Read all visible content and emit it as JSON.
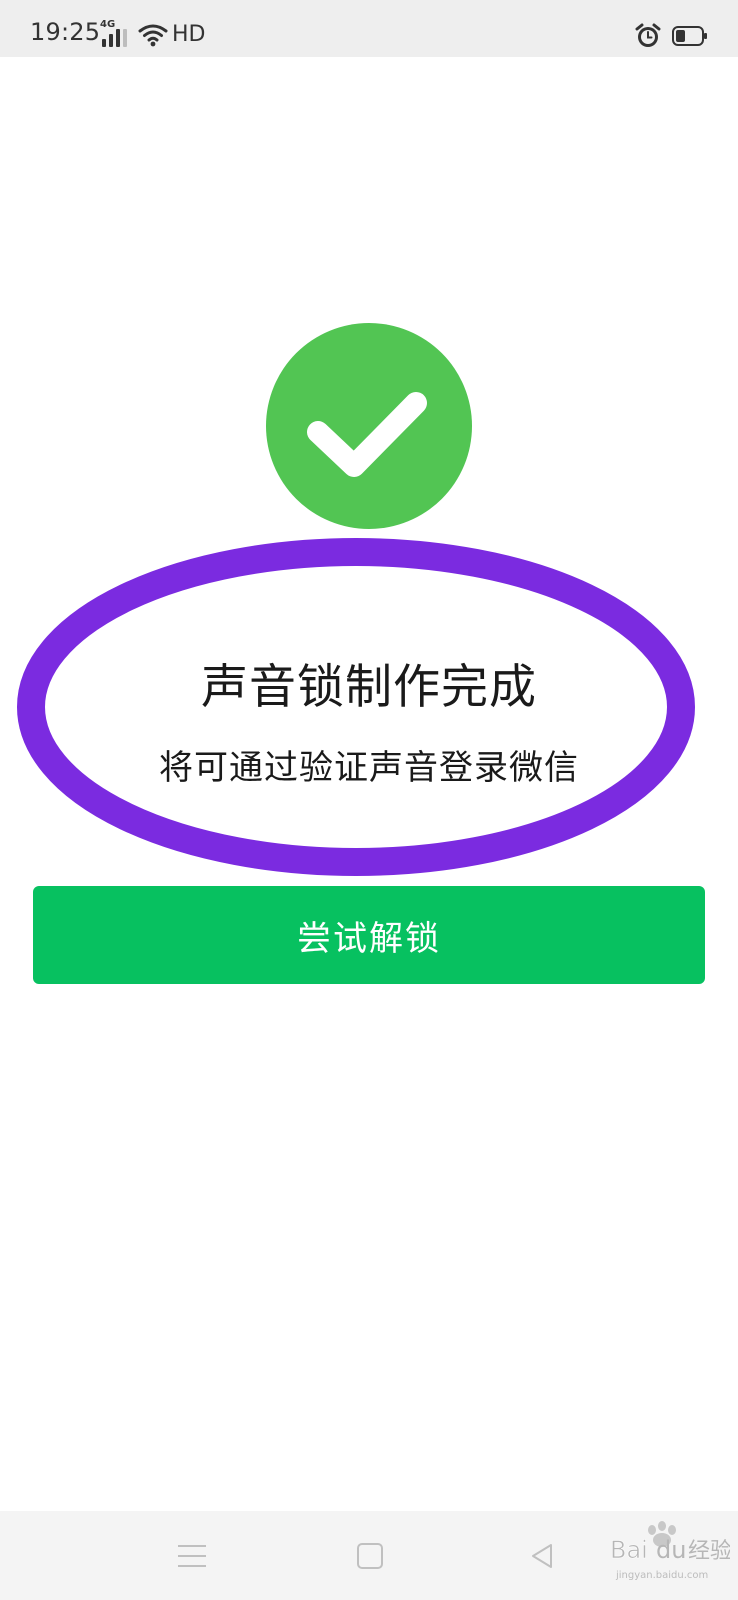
{
  "status_bar": {
    "time": "19:25",
    "network": "4G",
    "hd": "HD",
    "icons": [
      "signal-icon",
      "wifi-icon",
      "alarm-icon",
      "battery-icon"
    ]
  },
  "result": {
    "icon": "check-icon",
    "title": "声音锁制作完成",
    "subtitle": "将可通过验证声音登录微信"
  },
  "actions": {
    "try_unlock_label": "尝试解锁"
  },
  "nav_bar": {
    "icons": [
      "menu-icon",
      "home-icon",
      "back-icon"
    ]
  },
  "watermark": {
    "brand": "Baidu经验",
    "url": "jingyan.baidu.com"
  },
  "colors": {
    "success": "#52c553",
    "button": "#07c160",
    "highlight": "#7b2be0"
  }
}
